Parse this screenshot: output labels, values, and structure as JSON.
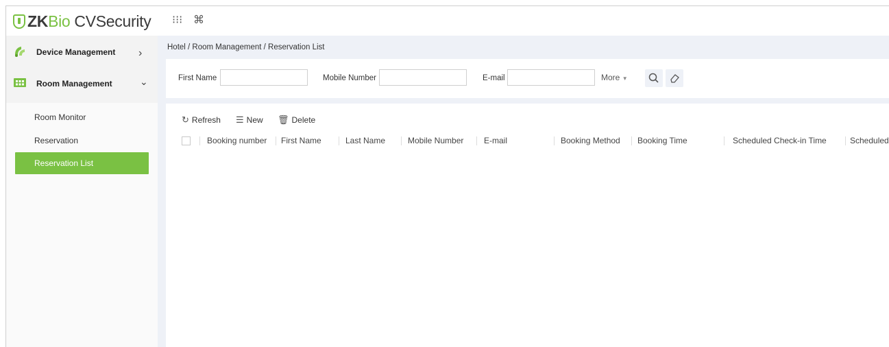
{
  "app": {
    "logo_zk": "ZK",
    "logo_bio": "Bio",
    "logo_cv": "CVSecurity",
    "apps_icon": "⁝⁝⁝",
    "cmd_icon": "⌘"
  },
  "sidebar": {
    "groups": [
      {
        "label": "Device Management",
        "icon": "device-icon",
        "chevron": "›"
      },
      {
        "label": "Room Management",
        "icon": "room-icon",
        "chevron": "⌄"
      }
    ],
    "items": [
      {
        "label": "Room Monitor"
      },
      {
        "label": "Reservation"
      },
      {
        "label": "Reservation List"
      }
    ],
    "accent": "#7ac143"
  },
  "breadcrumb": "Hotel / Room Management / Reservation List",
  "filter": {
    "first_name_label": "First Name",
    "first_name_value": "",
    "mobile_label": "Mobile Number",
    "mobile_value": "",
    "email_label": "E-mail",
    "email_value": "",
    "more_label": "More",
    "search_icon": "search-icon",
    "clear_icon": "eraser-icon"
  },
  "toolbar": {
    "refresh": "Refresh",
    "new": "New",
    "delete": "Delete"
  },
  "table": {
    "columns": [
      "Booking number",
      "First Name",
      "Last Name",
      "Mobile Number",
      "E-mail",
      "Booking Method",
      "Booking Time",
      "Scheduled Check-in Time",
      "Scheduled"
    ],
    "rows": []
  }
}
